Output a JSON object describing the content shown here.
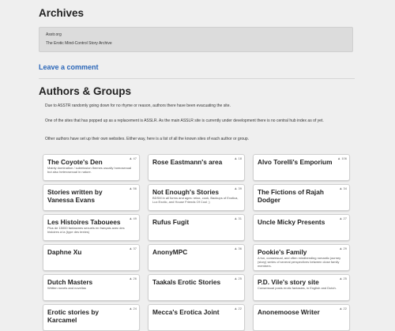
{
  "archives": {
    "heading": "Archives",
    "lines": [
      "Asstr.org",
      "The Erotic Mind-Control Story Archive"
    ]
  },
  "leave_comment": "Leave a comment",
  "authors": {
    "heading": "Authors & Groups",
    "paragraphs": [
      "Due to ASSTR randomly going down for no rhyme or reason, authors there have been evacuating the site.",
      "One of the sites that has popped up as a replacement is ASSLR. As the main ASSLR site is currently under development there is no central hub index as of yet.",
      "Other authors have set up their own websites. Either way, here is a list of all the known sites of each author or group."
    ]
  },
  "cards": [
    {
      "title": "The Coyote's Den",
      "desc": "Mainly domination / submission themes usually homosexual but also heterosexual in nature.",
      "count": "47"
    },
    {
      "title": "Rose Eastmann's area",
      "desc": "",
      "count": "18"
    },
    {
      "title": "Alvo Torelli's Emporium",
      "desc": "",
      "count": "106"
    },
    {
      "title": "Stories written by Vanessa Evans",
      "desc": "",
      "count": "56"
    },
    {
      "title": "Not Enough's Stories",
      "desc": "BDSM in all forms and ages: relax, cook, Backups of Exotica, Lux Exotic, and House Friends Of Cool ;)",
      "count": "39"
    },
    {
      "title": "The Fictions of Rajah Dodger",
      "desc": "",
      "count": "34"
    },
    {
      "title": "Les Histoires Tabouees",
      "desc": "Plus de 15000 fantasmes sexuels en français avec des histoires à la (type des textes)",
      "count": "49"
    },
    {
      "title": "Rufus Fugit",
      "desc": "",
      "count": "31"
    },
    {
      "title": "Uncle Micky Presents",
      "desc": "",
      "count": "27"
    },
    {
      "title": "Daphne Xu",
      "desc": "",
      "count": "37"
    },
    {
      "title": "AnonyMPC",
      "desc": "",
      "count": "36"
    },
    {
      "title": "Pookie's Family",
      "desc": "A fun, consensual, and often mindbending romantic journey (story) series of several perspectives between close family members.",
      "count": "29"
    },
    {
      "title": "Dutch Masters",
      "desc": "Written novels and novellas",
      "count": "26"
    },
    {
      "title": "Taakals Erotic Stories",
      "desc": "",
      "count": "25"
    },
    {
      "title": "P.D. Vile's story site",
      "desc": "Consensual posts erotic fantasies, in English and Dutch.",
      "count": "25"
    },
    {
      "title": "Erotic stories by Karcamel",
      "desc": "",
      "count": "24"
    },
    {
      "title": "Mecca's Erotica Joint",
      "desc": "",
      "count": "22"
    },
    {
      "title": "Anonemoose Writer",
      "desc": "",
      "count": "22"
    }
  ],
  "icons": {
    "count_icon": "thumb-icon"
  }
}
